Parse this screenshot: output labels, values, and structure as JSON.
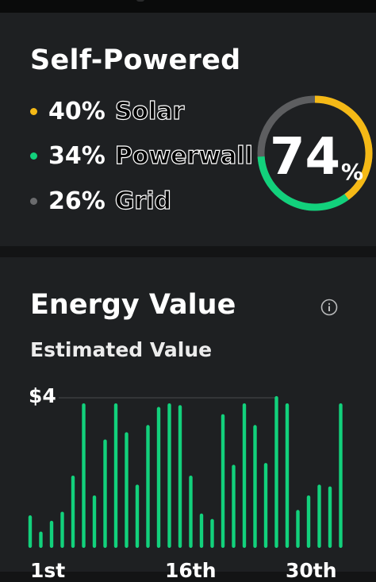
{
  "self_powered": {
    "title": "Self-Powered",
    "total_percent": "74",
    "percent_sign": "%",
    "sources": [
      {
        "pct": "40%",
        "name": "Solar",
        "color": "#f5b916",
        "fraction": 0.4
      },
      {
        "pct": "34%",
        "name": "Powerwall",
        "color": "#12d17c",
        "fraction": 0.34
      },
      {
        "pct": "26%",
        "name": "Grid",
        "color": "#6a6b6d",
        "fraction": 0.26
      }
    ]
  },
  "energy_value": {
    "title": "Energy Value",
    "info_icon": "info-icon",
    "subtitle": "Estimated Value",
    "chart_data": {
      "type": "bar",
      "ylim": [
        0,
        4
      ],
      "y_max_label": "$4",
      "x_tick_labels": [
        "1st",
        "16th",
        "30th"
      ],
      "color": "#12d17c",
      "values": [
        0.9,
        0.45,
        0.75,
        1.0,
        2.0,
        4.0,
        1.45,
        3.0,
        4.0,
        3.2,
        1.75,
        3.4,
        3.9,
        4.0,
        3.95,
        2.0,
        0.95,
        0.8,
        3.7,
        2.3,
        4.0,
        3.4,
        2.35,
        4.2,
        4.0,
        1.05,
        1.45,
        1.75,
        1.7,
        4.0
      ]
    }
  }
}
